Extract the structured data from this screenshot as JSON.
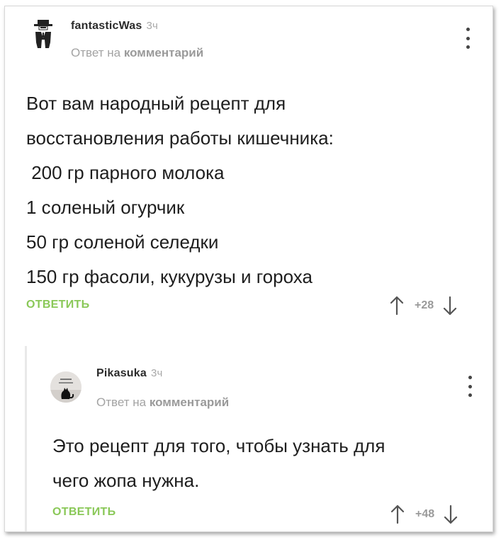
{
  "comments": [
    {
      "author": "fantasticWas",
      "time": "3ч",
      "reply_prefix": "Ответ на",
      "reply_target": "комментарий",
      "lines": [
        "Вот вам народный рецепт для",
        "восстановления работы кишечника:",
        " 200 гр парного молока",
        "1 соленый огурчик",
        "50 гр соленой селедки",
        "150 гр фасоли, кукурузы и гороха"
      ],
      "reply_label": "ОТВЕТИТЬ",
      "rating": "+28"
    },
    {
      "author": "Pikasuka",
      "time": "3ч",
      "reply_prefix": "Ответ на",
      "reply_target": "комментарий",
      "lines": [
        "Это рецепт для того, чтобы узнать для",
        "чего жопа нужна."
      ],
      "reply_label": "ОТВЕТИТЬ",
      "rating": "+48"
    }
  ],
  "colors": {
    "accent_green": "#8ac858",
    "muted_gray": "#a3a3a3",
    "text_dark": "#1e1e1e"
  },
  "icons": [
    "spy-avatar-icon",
    "cat-avatar-icon",
    "more-dots-icon",
    "arrow-up-icon",
    "arrow-down-icon"
  ]
}
